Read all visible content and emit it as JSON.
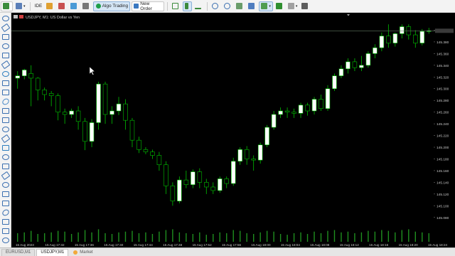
{
  "toolbar": {
    "buttons": [
      {
        "name": "new-chart-icon",
        "label": ""
      },
      {
        "name": "profiles-icon",
        "label": ""
      },
      {
        "name": "ide-button",
        "label": "IDE"
      },
      {
        "name": "history-icon",
        "label": ""
      },
      {
        "name": "signals-icon",
        "label": ""
      },
      {
        "name": "market-icon",
        "label": ""
      }
    ],
    "algo_trading_label": "Algo Trading",
    "new_order_label": "New Order"
  },
  "chart": {
    "symbol_label": "USDJPY, M1:  US Dollar vs Yen",
    "colors": {
      "background": "#000000",
      "bull": "#ffffff",
      "bear": "#ffffff",
      "wick": "#00c000",
      "volume": "#1f8f1f",
      "grid": "#0a0a0a",
      "axis_text": "#c8c8c8",
      "price_line": "#607a60"
    },
    "price_axis": [
      "145.400",
      "145.380",
      "145.360",
      "145.340",
      "145.320",
      "145.300",
      "145.280",
      "145.260",
      "145.240",
      "145.220",
      "145.200",
      "145.180",
      "145.160",
      "145.140",
      "145.120",
      "145.100",
      "145.080"
    ],
    "time_axis": [
      "15 Aug 2023",
      "15 Aug 17:32",
      "15 Aug 17:36",
      "15 Aug 17:40",
      "15 Aug 17:44",
      "15 Aug 17:48",
      "15 Aug 17:52",
      "15 Aug 17:56",
      "15 Aug 18:00",
      "15 Aug 18:04",
      "15 Aug 18:08",
      "15 Aug 18:12",
      "15 Aug 18:16",
      "15 Aug 18:20",
      "15 Aug 18:24"
    ],
    "current_price_line": 145.399
  },
  "chart_data": {
    "type": "candlestick",
    "ylim": [
      145.07,
      145.42
    ],
    "candles": [
      {
        "o": 145.318,
        "h": 145.33,
        "l": 145.3,
        "c": 145.322
      },
      {
        "o": 145.322,
        "h": 145.334,
        "l": 145.316,
        "c": 145.332
      },
      {
        "o": 145.326,
        "h": 145.34,
        "l": 145.27,
        "c": 145.318
      },
      {
        "o": 145.318,
        "h": 145.32,
        "l": 145.28,
        "c": 145.298
      },
      {
        "o": 145.298,
        "h": 145.302,
        "l": 145.28,
        "c": 145.29
      },
      {
        "o": 145.292,
        "h": 145.296,
        "l": 145.27,
        "c": 145.288
      },
      {
        "o": 145.288,
        "h": 145.292,
        "l": 145.246,
        "c": 145.26
      },
      {
        "o": 145.26,
        "h": 145.266,
        "l": 145.24,
        "c": 145.256
      },
      {
        "o": 145.256,
        "h": 145.266,
        "l": 145.25,
        "c": 145.262
      },
      {
        "o": 145.262,
        "h": 145.27,
        "l": 145.23,
        "c": 145.244
      },
      {
        "o": 145.244,
        "h": 145.25,
        "l": 145.195,
        "c": 145.21
      },
      {
        "o": 145.21,
        "h": 145.248,
        "l": 145.2,
        "c": 145.242
      },
      {
        "o": 145.242,
        "h": 145.312,
        "l": 145.23,
        "c": 145.308
      },
      {
        "o": 145.308,
        "h": 145.312,
        "l": 145.24,
        "c": 145.256
      },
      {
        "o": 145.256,
        "h": 145.27,
        "l": 145.24,
        "c": 145.262
      },
      {
        "o": 145.262,
        "h": 145.286,
        "l": 145.255,
        "c": 145.274
      },
      {
        "o": 145.274,
        "h": 145.282,
        "l": 145.23,
        "c": 145.246
      },
      {
        "o": 145.246,
        "h": 145.25,
        "l": 145.2,
        "c": 145.212
      },
      {
        "o": 145.212,
        "h": 145.218,
        "l": 145.19,
        "c": 145.196
      },
      {
        "o": 145.196,
        "h": 145.2,
        "l": 145.188,
        "c": 145.192
      },
      {
        "o": 145.192,
        "h": 145.196,
        "l": 145.18,
        "c": 145.186
      },
      {
        "o": 145.186,
        "h": 145.192,
        "l": 145.16,
        "c": 145.17
      },
      {
        "o": 145.17,
        "h": 145.176,
        "l": 145.12,
        "c": 145.134
      },
      {
        "o": 145.134,
        "h": 145.14,
        "l": 145.1,
        "c": 145.108
      },
      {
        "o": 145.108,
        "h": 145.15,
        "l": 145.104,
        "c": 145.144
      },
      {
        "o": 145.144,
        "h": 145.16,
        "l": 145.13,
        "c": 145.136
      },
      {
        "o": 145.136,
        "h": 145.162,
        "l": 145.13,
        "c": 145.158
      },
      {
        "o": 145.158,
        "h": 145.164,
        "l": 145.13,
        "c": 145.14
      },
      {
        "o": 145.14,
        "h": 145.146,
        "l": 145.12,
        "c": 145.132
      },
      {
        "o": 145.132,
        "h": 145.14,
        "l": 145.12,
        "c": 145.126
      },
      {
        "o": 145.126,
        "h": 145.15,
        "l": 145.122,
        "c": 145.146
      },
      {
        "o": 145.146,
        "h": 145.15,
        "l": 145.13,
        "c": 145.138
      },
      {
        "o": 145.138,
        "h": 145.182,
        "l": 145.134,
        "c": 145.176
      },
      {
        "o": 145.176,
        "h": 145.2,
        "l": 145.17,
        "c": 145.196
      },
      {
        "o": 145.196,
        "h": 145.202,
        "l": 145.17,
        "c": 145.18
      },
      {
        "o": 145.18,
        "h": 145.186,
        "l": 145.16,
        "c": 145.178
      },
      {
        "o": 145.178,
        "h": 145.208,
        "l": 145.172,
        "c": 145.204
      },
      {
        "o": 145.204,
        "h": 145.238,
        "l": 145.2,
        "c": 145.234
      },
      {
        "o": 145.234,
        "h": 145.262,
        "l": 145.23,
        "c": 145.256
      },
      {
        "o": 145.256,
        "h": 145.268,
        "l": 145.25,
        "c": 145.262
      },
      {
        "o": 145.262,
        "h": 145.268,
        "l": 145.25,
        "c": 145.26
      },
      {
        "o": 145.26,
        "h": 145.266,
        "l": 145.25,
        "c": 145.258
      },
      {
        "o": 145.258,
        "h": 145.276,
        "l": 145.25,
        "c": 145.272
      },
      {
        "o": 145.272,
        "h": 145.276,
        "l": 145.254,
        "c": 145.262
      },
      {
        "o": 145.262,
        "h": 145.286,
        "l": 145.256,
        "c": 145.282
      },
      {
        "o": 145.282,
        "h": 145.29,
        "l": 145.262,
        "c": 145.266
      },
      {
        "o": 145.266,
        "h": 145.306,
        "l": 145.262,
        "c": 145.3
      },
      {
        "o": 145.3,
        "h": 145.326,
        "l": 145.296,
        "c": 145.322
      },
      {
        "o": 145.322,
        "h": 145.34,
        "l": 145.318,
        "c": 145.334
      },
      {
        "o": 145.334,
        "h": 145.352,
        "l": 145.326,
        "c": 145.346
      },
      {
        "o": 145.346,
        "h": 145.352,
        "l": 145.33,
        "c": 145.336
      },
      {
        "o": 145.336,
        "h": 145.356,
        "l": 145.33,
        "c": 145.34
      },
      {
        "o": 145.34,
        "h": 145.364,
        "l": 145.336,
        "c": 145.36
      },
      {
        "o": 145.36,
        "h": 145.376,
        "l": 145.352,
        "c": 145.37
      },
      {
        "o": 145.37,
        "h": 145.396,
        "l": 145.364,
        "c": 145.39
      },
      {
        "o": 145.39,
        "h": 145.41,
        "l": 145.37,
        "c": 145.378
      },
      {
        "o": 145.378,
        "h": 145.396,
        "l": 145.372,
        "c": 145.394
      },
      {
        "o": 145.394,
        "h": 145.41,
        "l": 145.386,
        "c": 145.406
      },
      {
        "o": 145.406,
        "h": 145.41,
        "l": 145.384,
        "c": 145.392
      },
      {
        "o": 145.392,
        "h": 145.4,
        "l": 145.37,
        "c": 145.378
      },
      {
        "o": 145.378,
        "h": 145.402,
        "l": 145.374,
        "c": 145.398
      },
      {
        "o": 145.398,
        "h": 145.404,
        "l": 145.394,
        "c": 145.399
      }
    ],
    "volumes": [
      0.55,
      0.6,
      0.7,
      0.5,
      0.55,
      0.6,
      0.7,
      0.65,
      0.5,
      0.6,
      0.75,
      0.6,
      0.8,
      0.55,
      0.5,
      0.6,
      0.65,
      0.7,
      0.55,
      0.6,
      0.5,
      0.65,
      0.75,
      0.8,
      0.6,
      0.55,
      0.5,
      0.6,
      0.45,
      0.5,
      0.6,
      0.55,
      0.75,
      0.7,
      0.55,
      0.5,
      0.6,
      0.7,
      0.65,
      0.5,
      0.45,
      0.55,
      0.6,
      0.5,
      0.65,
      0.55,
      0.7,
      0.75,
      0.6,
      0.65,
      0.55,
      0.6,
      0.7,
      0.65,
      0.75,
      0.7,
      0.6,
      0.75,
      0.8,
      0.65,
      0.6,
      0.55
    ]
  },
  "tabs": {
    "items": [
      "EURUSD,M1",
      "USDJPY,M1"
    ],
    "active": 1,
    "market_label": "Market"
  }
}
